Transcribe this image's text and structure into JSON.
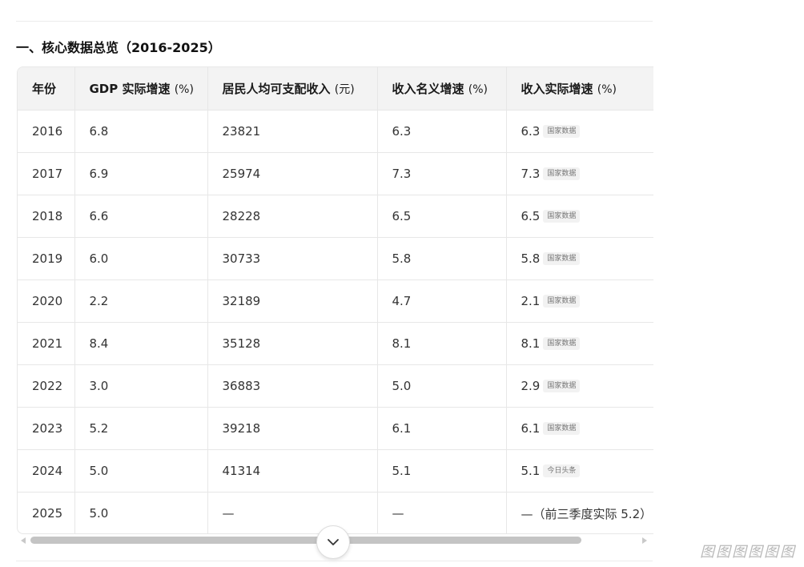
{
  "section": {
    "title": "一、核心数据总览（2016-2025）"
  },
  "table": {
    "headers": [
      {
        "label": "年份",
        "unit": ""
      },
      {
        "label": "GDP 实际增速 ",
        "unit": "(%)"
      },
      {
        "label": "居民人均可支配收入 ",
        "unit": "(元)"
      },
      {
        "label": "收入名义增速 ",
        "unit": "(%)"
      },
      {
        "label": "收入实际增速 ",
        "unit": "(%)"
      }
    ],
    "rows": [
      {
        "year": "2016",
        "gdp": "6.8",
        "income": "23821",
        "nominal": "6.3",
        "real": "6.3",
        "source": "国家数据"
      },
      {
        "year": "2017",
        "gdp": "6.9",
        "income": "25974",
        "nominal": "7.3",
        "real": "7.3",
        "source": "国家数据"
      },
      {
        "year": "2018",
        "gdp": "6.6",
        "income": "28228",
        "nominal": "6.5",
        "real": "6.5",
        "source": "国家数据"
      },
      {
        "year": "2019",
        "gdp": "6.0",
        "income": "30733",
        "nominal": "5.8",
        "real": "5.8",
        "source": "国家数据"
      },
      {
        "year": "2020",
        "gdp": "2.2",
        "income": "32189",
        "nominal": "4.7",
        "real": "2.1",
        "source": "国家数据"
      },
      {
        "year": "2021",
        "gdp": "8.4",
        "income": "35128",
        "nominal": "8.1",
        "real": "8.1",
        "source": "国家数据"
      },
      {
        "year": "2022",
        "gdp": "3.0",
        "income": "36883",
        "nominal": "5.0",
        "real": "2.9",
        "source": "国家数据"
      },
      {
        "year": "2023",
        "gdp": "5.2",
        "income": "39218",
        "nominal": "6.1",
        "real": "6.1",
        "source": "国家数据"
      },
      {
        "year": "2024",
        "gdp": "5.0",
        "income": "41314",
        "nominal": "5.1",
        "real": "5.1",
        "source": "今日头条"
      },
      {
        "year": "2025",
        "gdp": "5.0",
        "income": "—",
        "nominal": "—",
        "real": "—（前三季度实际 5.2）",
        "source": ""
      }
    ]
  },
  "controls": {
    "expand_icon": "chevron-down-icon"
  },
  "watermark": "图图图图图图"
}
